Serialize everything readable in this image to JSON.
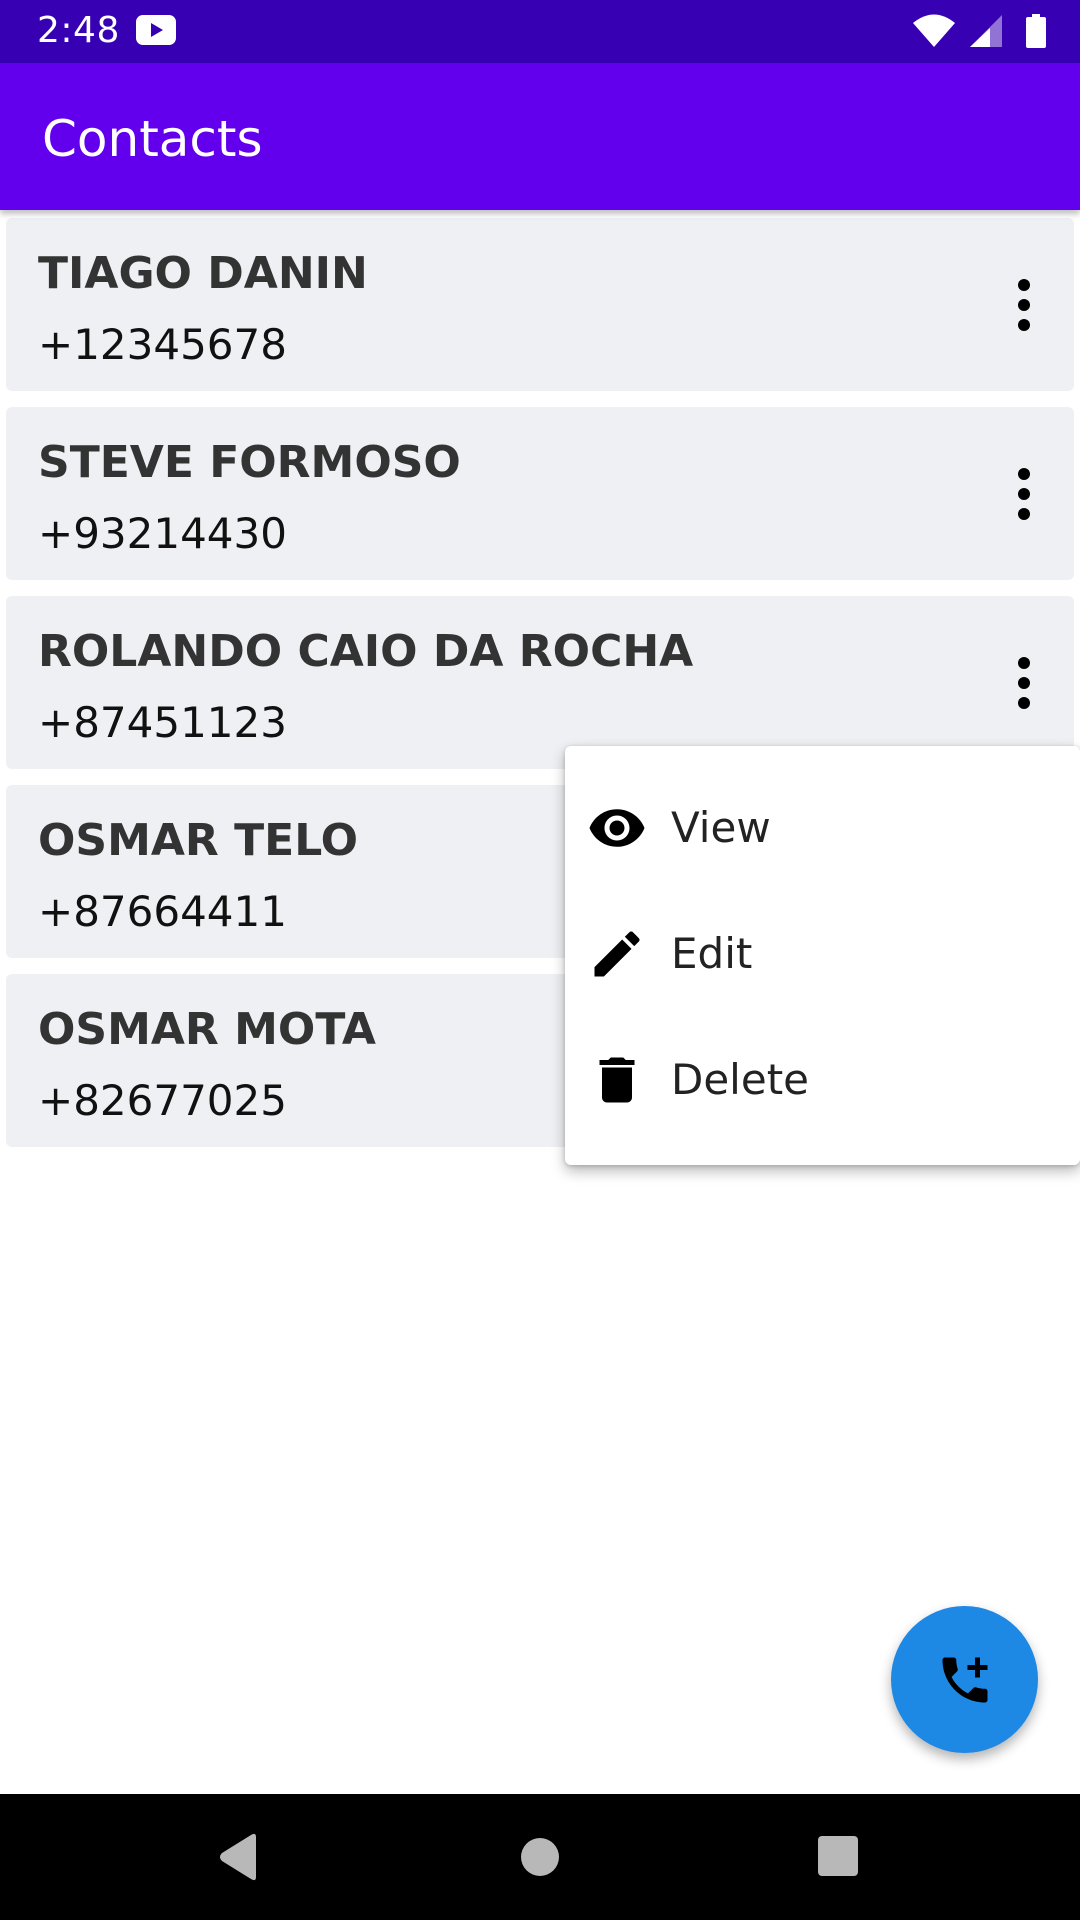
{
  "status_bar": {
    "time": "2:48",
    "icons": [
      "youtube-icon",
      "wifi-icon",
      "signal-icon",
      "battery-icon"
    ]
  },
  "app_bar": {
    "title": "Contacts"
  },
  "contacts": [
    {
      "name": "TIAGO DANIN",
      "phone": "+12345678"
    },
    {
      "name": "STEVE FORMOSO",
      "phone": "+93214430"
    },
    {
      "name": "ROLANDO CAIO DA ROCHA",
      "phone": "+87451123"
    },
    {
      "name": "OSMAR TELO",
      "phone": "+87664411"
    },
    {
      "name": "OSMAR MOTA",
      "phone": "+82677025"
    }
  ],
  "popup_menu": {
    "items": [
      {
        "label": "View",
        "icon": "eye-icon"
      },
      {
        "label": "Edit",
        "icon": "pencil-icon"
      },
      {
        "label": "Delete",
        "icon": "trash-icon"
      }
    ]
  },
  "fab": {
    "icon": "add-call-icon"
  },
  "colors": {
    "status_bar": "#3700b3",
    "app_bar": "#6200ee",
    "card": "#eef0f4",
    "fab": "#1e88e5",
    "nav_bar": "#000000"
  }
}
